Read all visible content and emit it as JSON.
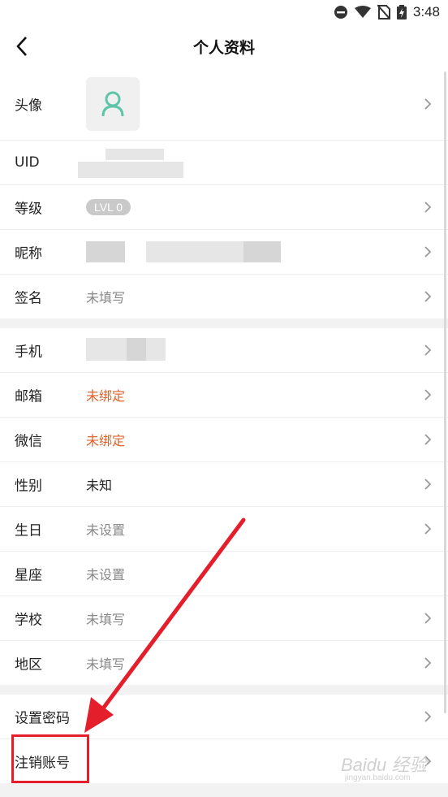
{
  "status_bar": {
    "time": "3:48",
    "icons": [
      "dnd-icon",
      "wifi-icon",
      "no-signal-icon",
      "battery-charging-icon"
    ]
  },
  "header": {
    "title": "个人资料",
    "back_icon": "back-arrow-icon"
  },
  "profile": {
    "rows_group1": [
      {
        "label": "头像",
        "type": "avatar",
        "chevron": true
      },
      {
        "label": "UID",
        "type": "blurred",
        "chevron": false
      },
      {
        "label": "等级",
        "type": "badge",
        "value": "LVL 0",
        "chevron": true
      },
      {
        "label": "昵称",
        "type": "blurred",
        "chevron": true
      },
      {
        "label": "签名",
        "type": "text",
        "value": "未填写",
        "chevron": true
      }
    ],
    "rows_group2": [
      {
        "label": "手机",
        "type": "blurred",
        "chevron": true
      },
      {
        "label": "邮箱",
        "type": "accent",
        "value": "未绑定",
        "chevron": true
      },
      {
        "label": "微信",
        "type": "accent",
        "value": "未绑定",
        "chevron": true
      },
      {
        "label": "性别",
        "type": "dark",
        "value": "未知",
        "chevron": true
      },
      {
        "label": "生日",
        "type": "text",
        "value": "未设置",
        "chevron": true
      },
      {
        "label": "星座",
        "type": "text",
        "value": "未设置",
        "chevron": false
      },
      {
        "label": "学校",
        "type": "text",
        "value": "未填写",
        "chevron": true
      },
      {
        "label": "地区",
        "type": "text",
        "value": "未填写",
        "chevron": true
      }
    ],
    "rows_group3": [
      {
        "label": "设置密码",
        "chevron": true
      },
      {
        "label": "注销账号",
        "chevron": true
      }
    ]
  },
  "colors": {
    "accent": "#e0602a",
    "annotation": "#e41e2b",
    "avatar_icon": "#5ec5a8"
  },
  "watermark": {
    "main": "Baidu 经验",
    "sub": "jingyan.baidu.com"
  }
}
